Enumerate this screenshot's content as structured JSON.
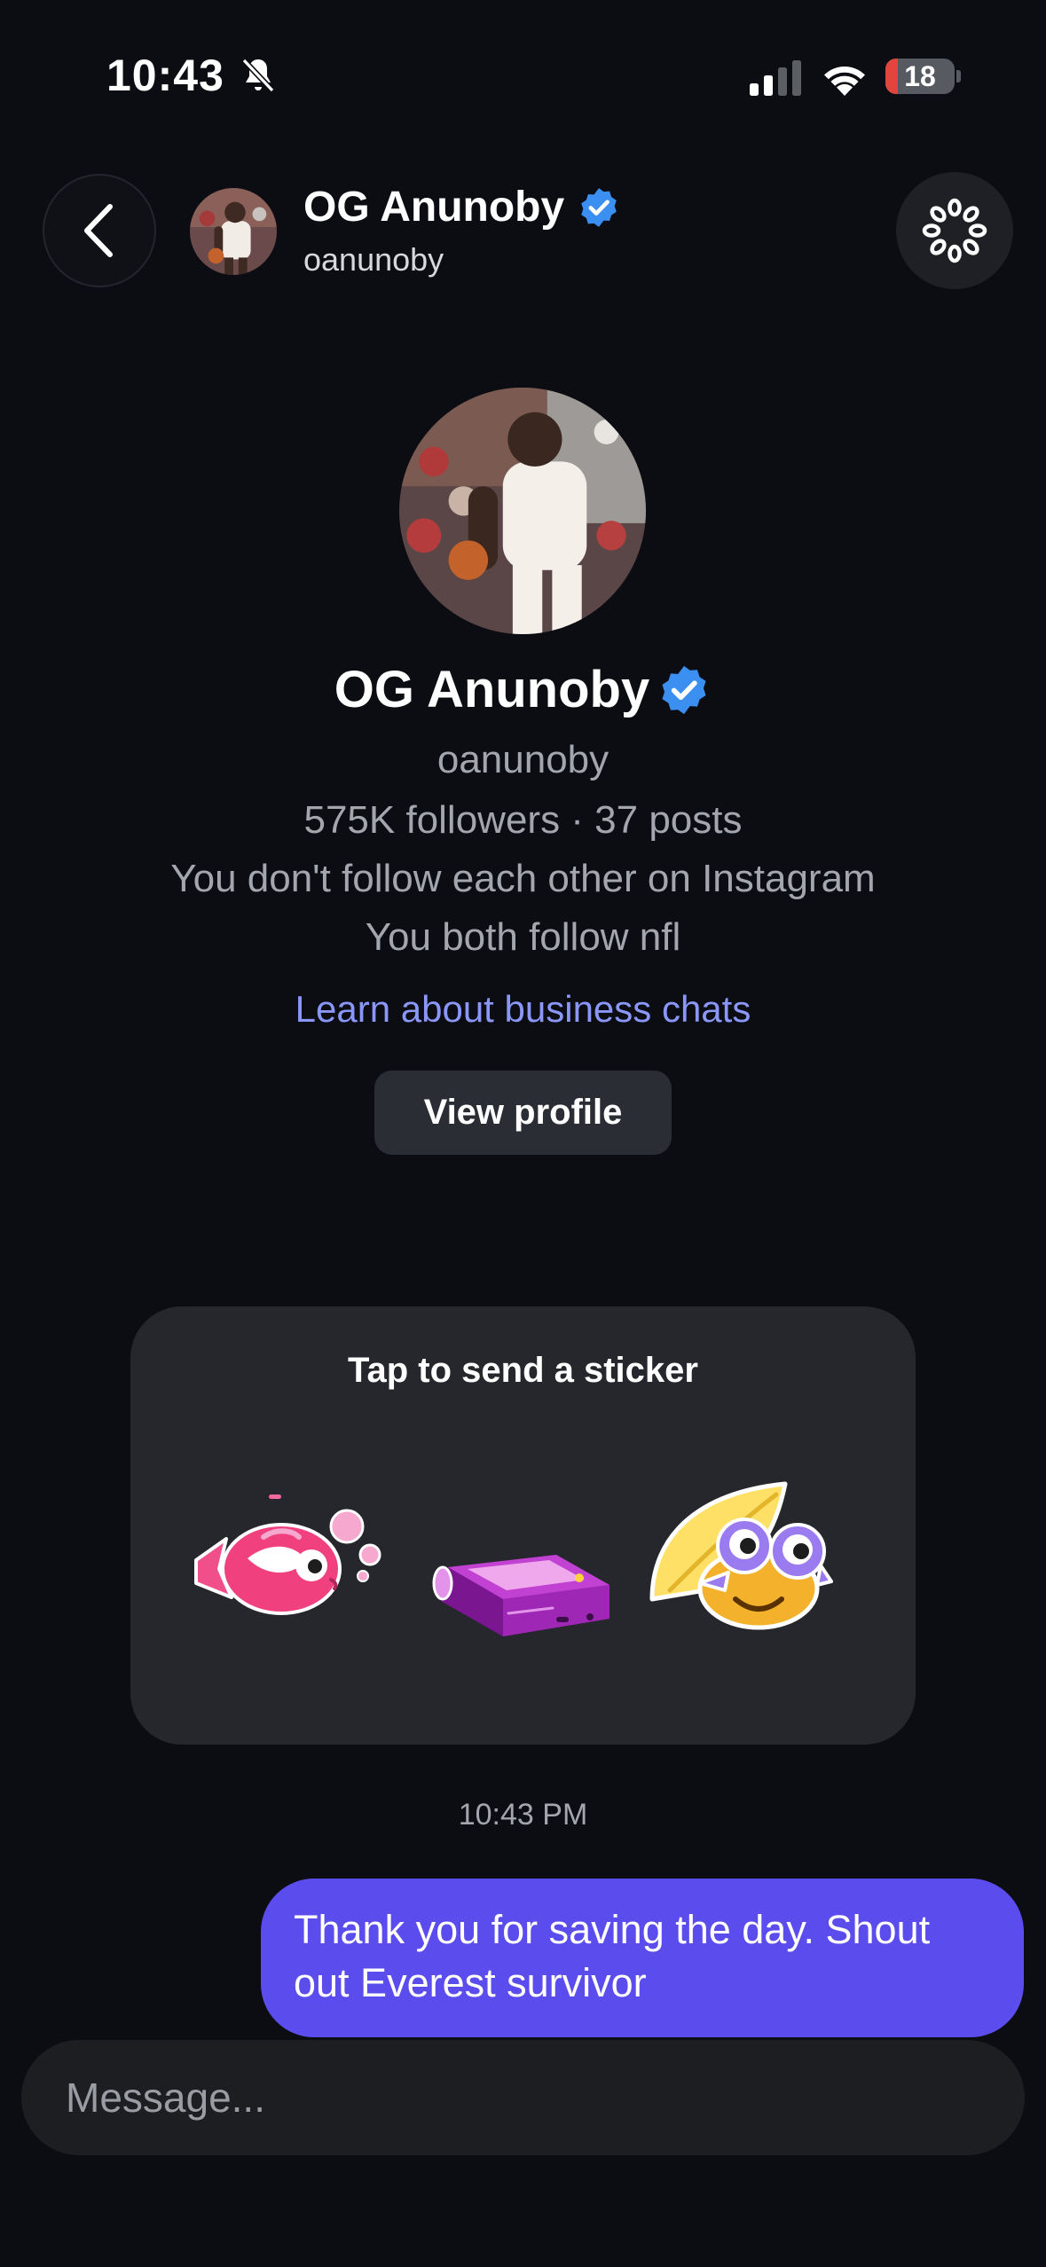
{
  "status_bar": {
    "time": "10:43",
    "battery_level": "18",
    "battery_fraction": 0.18,
    "icons": [
      "bell-slash-icon",
      "cellular-signal-icon",
      "wifi-icon",
      "battery-icon"
    ]
  },
  "header": {
    "name": "OG Anunoby",
    "username": "oanunoby",
    "icons": [
      "chevron-left-icon",
      "verified-badge-icon",
      "chat-theme-icon"
    ]
  },
  "profile": {
    "name": "OG Anunoby",
    "username": "oanunoby",
    "stats": "575K followers · 37 posts",
    "follow_status": "You don't follow each other on Instagram",
    "mutual": "You both follow nfl",
    "learn_link": "Learn about business chats",
    "view_profile_label": "View profile"
  },
  "sticker_prompt": {
    "title": "Tap to send a sticker",
    "stickers": [
      "fish-sticker",
      "pager-sticker",
      "leaf-creature-sticker"
    ]
  },
  "conversation": {
    "timestamp": "10:43 PM",
    "messages": [
      {
        "direction": "outgoing",
        "text": "Thank you for saving the day. Shout out Everest survivor"
      }
    ]
  },
  "composer": {
    "placeholder": "Message..."
  },
  "colors": {
    "background": "#0b0d12",
    "accent_bubble": "#5b4ded",
    "link": "#8b97f8",
    "verified": "#3a8ff0",
    "battery_low": "#e2453d"
  }
}
